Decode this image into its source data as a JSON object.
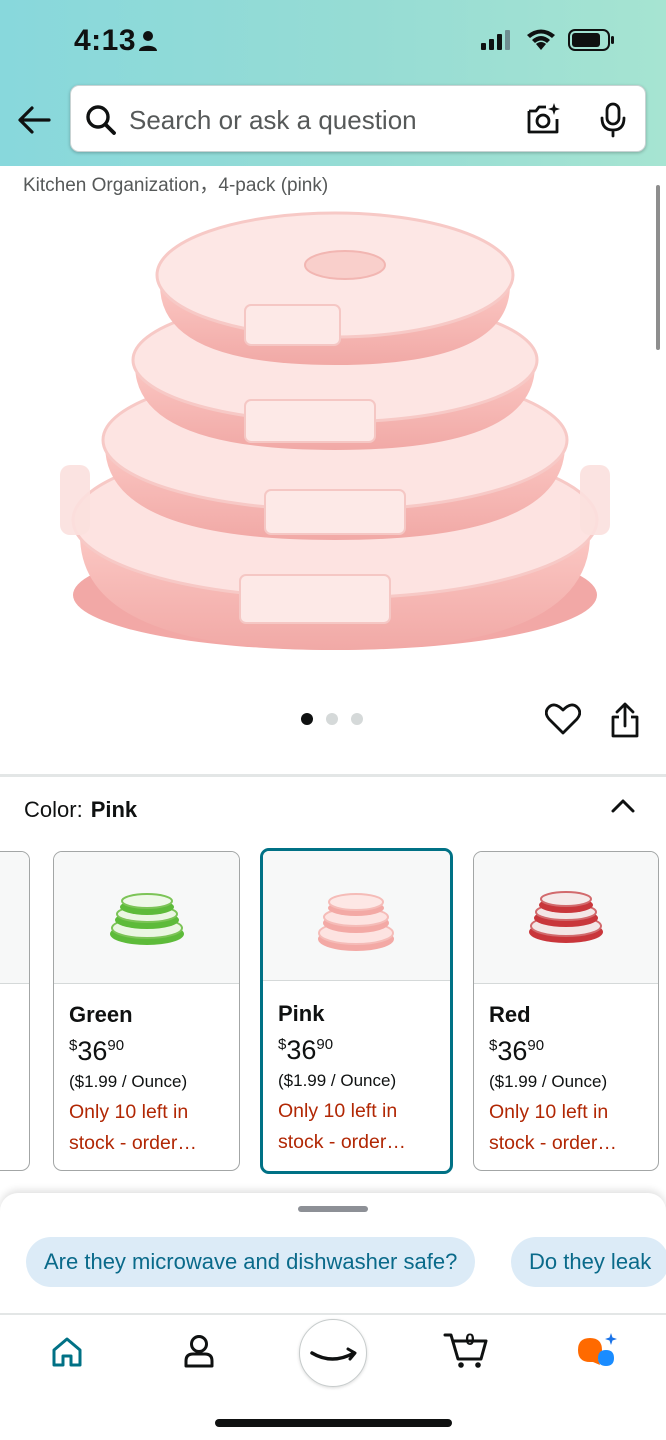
{
  "status_bar": {
    "time": "4:13"
  },
  "search": {
    "placeholder": "Search or ask a question"
  },
  "product": {
    "breadcrumb": "Kitchen Organization，4-pack (pink)",
    "image_pages": 3,
    "current_image": 1
  },
  "color": {
    "label": "Color:",
    "selected": "Pink",
    "options": [
      {
        "name": "Green",
        "currency": "$",
        "price_whole": "36",
        "price_cents": "90",
        "unit_price": "($1.99 / Ounce)",
        "stock": "Only 10 left in stock - order…"
      },
      {
        "name": "Pink",
        "currency": "$",
        "price_whole": "36",
        "price_cents": "90",
        "unit_price": "($1.99 / Ounce)",
        "stock": "Only 10 left in stock - order…"
      },
      {
        "name": "Red",
        "currency": "$",
        "price_whole": "36",
        "price_cents": "90",
        "unit_price": "($1.99 / Ounce)",
        "stock": "Only 10 left in stock - order…"
      }
    ]
  },
  "suggestions": [
    "Are they microwave and dishwasher safe?",
    "Do they leak"
  ],
  "bottom_nav": [
    "home-icon",
    "account-icon",
    "amazon-smile-icon",
    "cart-icon",
    "rufus-icon"
  ],
  "cart_count": "0",
  "colors": {
    "teal": "#007185",
    "stock_red": "#b12704",
    "chip_bg": "#dcebf7",
    "chip_text": "#0a6a8a"
  }
}
